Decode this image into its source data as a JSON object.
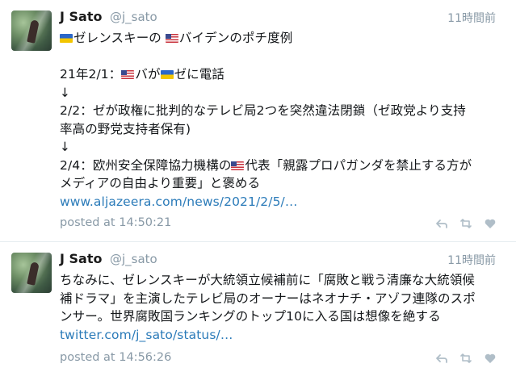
{
  "tweets": [
    {
      "name": "J Sato",
      "handle": "@j_sato",
      "time": "11時間前",
      "lines": {
        "l1": "ゼレンスキーの",
        "l1b": "バイデンのポチ度例",
        "l2": "21年2/1：",
        "l2b": "バが",
        "l2c": "ゼに電話",
        "arrow1": "↓",
        "l3": "2/2：ゼが政権に批判的なテレビ局2つを突然違法閉鎖（ゼ政党より支持",
        "l4": "率高の野党支持者保有)",
        "arrow2": "↓",
        "l5": "2/4：欧州安全保障協力機構の",
        "l5b": "代表「親露プロパガンダを禁止する方が",
        "l6": "メディアの自由より重要」と褒める"
      },
      "link": "www.aljazeera.com/news/2021/2/5/…",
      "posted": "posted at 14:50:21"
    },
    {
      "name": "J Sato",
      "handle": "@j_sato",
      "time": "11時間前",
      "lines": {
        "l1": "ちなみに、ゼレンスキーが大統領立候補前に「腐敗と戦う清廉な大統領候",
        "l2": "補ドラマ」を主演したテレビ局のオーナーはネオナチ・アゾフ連隊のスポ",
        "l3": "ンサー。世界腐敗国ランキングのトップ10に入る国は想像を絶する"
      },
      "link": "twitter.com/j_sato/status/…",
      "posted": "posted at 14:56:26"
    }
  ],
  "icons": {
    "reply": "reply-icon",
    "retweet": "retweet-icon",
    "like": "heart-icon",
    "flag_ukraine": "ukraine-flag-icon",
    "flag_usa": "usa-flag-icon"
  },
  "colors": {
    "link": "#2b7bb9",
    "meta": "#8899a6",
    "text": "#14171a",
    "divider": "#e6ecf0"
  }
}
